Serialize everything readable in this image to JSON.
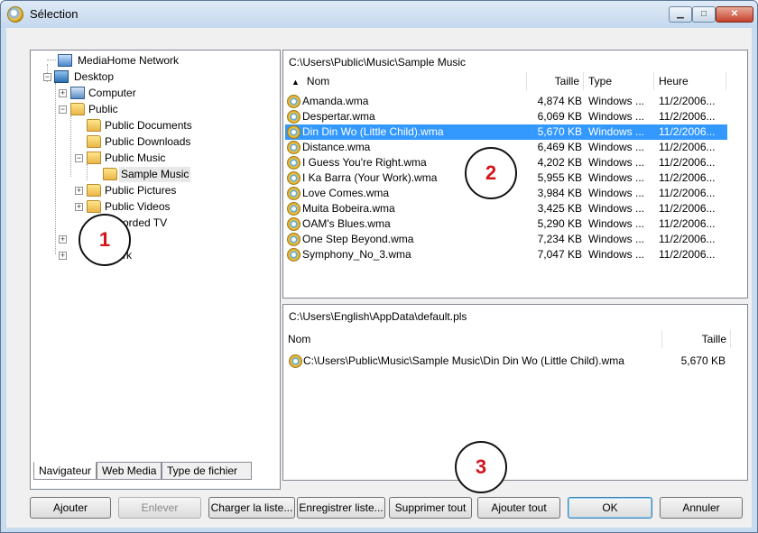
{
  "window": {
    "title": "Sélection",
    "min_glyph": "▁",
    "max_glyph": "□",
    "close_glyph": "✕"
  },
  "tree": {
    "items": [
      {
        "label": "MediaHome Network",
        "icon": "network-icon"
      },
      {
        "label": "Desktop",
        "icon": "desktop-icon"
      },
      {
        "label": "Computer",
        "icon": "computer-icon"
      },
      {
        "label": "Public",
        "icon": "folder-icon"
      },
      {
        "label": "Public Documents",
        "icon": "folder-icon"
      },
      {
        "label": "Public Downloads",
        "icon": "folder-icon"
      },
      {
        "label": "Public Music",
        "icon": "music-folder-icon"
      },
      {
        "label": "Sample Music",
        "icon": "folder-icon"
      },
      {
        "label": "Public Pictures",
        "icon": "folder-icon"
      },
      {
        "label": "Public Videos",
        "icon": "folder-icon"
      },
      {
        "label": "orded TV",
        "icon": "folder-icon"
      },
      {
        "label": "rk",
        "icon": "network-icon"
      }
    ]
  },
  "tabs": [
    "Navigateur",
    "Web Media",
    "Type de fichier"
  ],
  "browser": {
    "path": "C:\\Users\\Public\\Music\\Sample Music",
    "sort_glyph": "▲",
    "columns": [
      "Nom",
      "Taille",
      "Type",
      "Heure"
    ],
    "rows": [
      {
        "name": "Amanda.wma",
        "size": "4,874 KB",
        "type": "Windows ...",
        "time": "11/2/2006..."
      },
      {
        "name": "Despertar.wma",
        "size": "6,069 KB",
        "type": "Windows ...",
        "time": "11/2/2006..."
      },
      {
        "name": "Din Din Wo (Little Child).wma",
        "size": "5,670 KB",
        "type": "Windows ...",
        "time": "11/2/2006..."
      },
      {
        "name": "Distance.wma",
        "size": "6,469 KB",
        "type": "Windows ...",
        "time": "11/2/2006..."
      },
      {
        "name": "I Guess You're Right.wma",
        "size": "4,202 KB",
        "type": "Windows ...",
        "time": "11/2/2006..."
      },
      {
        "name": "I Ka Barra (Your Work).wma",
        "size": "5,955 KB",
        "type": "Windows ...",
        "time": "11/2/2006..."
      },
      {
        "name": "Love Comes.wma",
        "size": "3,984 KB",
        "type": "Windows ...",
        "time": "11/2/2006..."
      },
      {
        "name": "Muita Bobeira.wma",
        "size": "3,425 KB",
        "type": "Windows ...",
        "time": "11/2/2006..."
      },
      {
        "name": "OAM's Blues.wma",
        "size": "5,290 KB",
        "type": "Windows ...",
        "time": "11/2/2006..."
      },
      {
        "name": "One Step Beyond.wma",
        "size": "7,234 KB",
        "type": "Windows ...",
        "time": "11/2/2006..."
      },
      {
        "name": "Symphony_No_3.wma",
        "size": "7,047 KB",
        "type": "Windows ...",
        "time": "11/2/2006..."
      }
    ]
  },
  "playlist": {
    "path": "C:\\Users\\English\\AppData\\default.pls",
    "columns": [
      "Nom",
      "Taille"
    ],
    "rows": [
      {
        "name": "C:\\Users\\Public\\Music\\Sample Music\\Din Din Wo (Little Child).wma",
        "size": "5,670 KB"
      }
    ]
  },
  "callouts": [
    "1",
    "2",
    "3"
  ],
  "buttons": {
    "ajouter": "Ajouter",
    "enlever": "Enlever",
    "charger": "Charger la liste...",
    "enregistrer": "Enregistrer liste...",
    "supprimer_tout": "Supprimer tout",
    "ajouter_tout": "Ajouter tout",
    "ok": "OK",
    "annuler": "Annuler"
  },
  "colors": {
    "selection": "#3399ff",
    "callout_number": "#d4151c"
  }
}
